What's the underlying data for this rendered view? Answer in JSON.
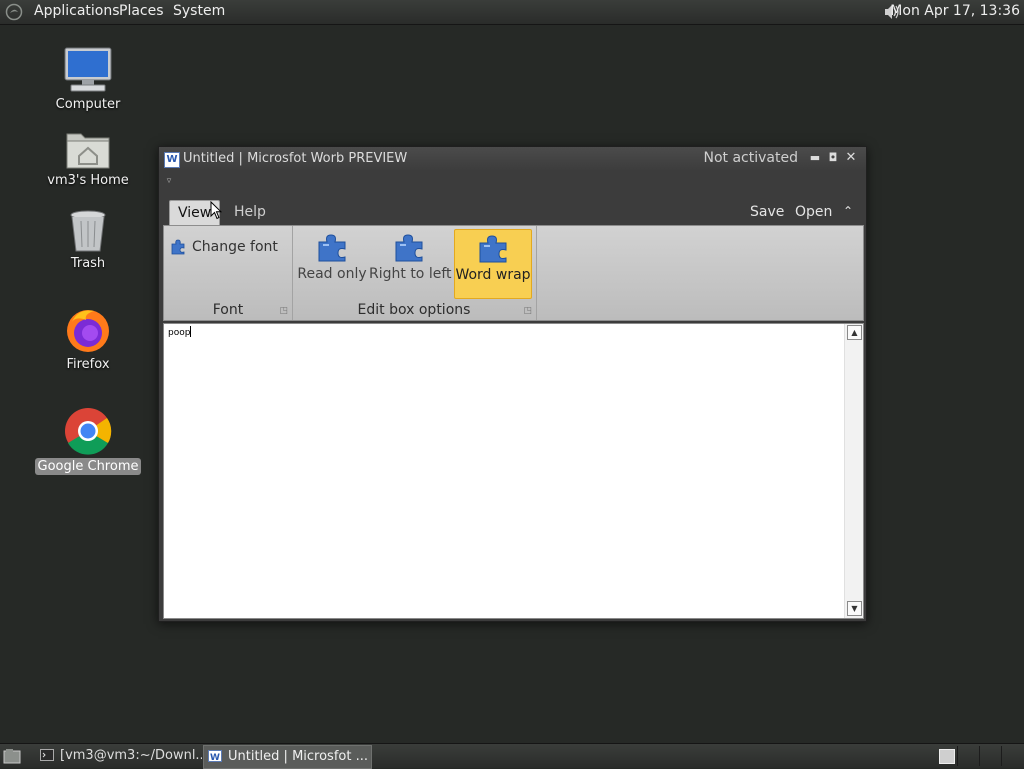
{
  "top_panel": {
    "menus": [
      "Applications",
      "Places",
      "System"
    ],
    "clock": "Mon Apr 17, 13:36"
  },
  "desktop": {
    "icons": [
      {
        "label": "Computer",
        "icon": "computer-icon"
      },
      {
        "label": "vm3's Home",
        "icon": "home-folder-icon"
      },
      {
        "label": "Trash",
        "icon": "trash-icon"
      },
      {
        "label": "Firefox",
        "icon": "firefox-icon"
      },
      {
        "label": "Google Chrome",
        "icon": "chrome-icon",
        "selected": true
      }
    ]
  },
  "window": {
    "title": "Untitled | Microsfot Worb PREVIEW",
    "status": "Not activated",
    "tabs": [
      "View",
      "Help"
    ],
    "active_tab": "View",
    "actions": {
      "save": "Save",
      "open": "Open"
    },
    "ribbon": {
      "font_group": {
        "title": "Font",
        "change_font": "Change font"
      },
      "editbox_group": {
        "title": "Edit box options",
        "read_only": "Read only",
        "right_to_left": "Right to left",
        "word_wrap": "Word wrap",
        "word_wrap_active": true
      }
    },
    "editor_text": "poop"
  },
  "taskbar": {
    "tasks": [
      {
        "label": "[vm3@vm3:~/Downl...",
        "icon": "terminal-icon"
      },
      {
        "label": "Untitled | Microsfot ...",
        "icon": "word-app-icon",
        "active": true
      }
    ]
  },
  "colors": {
    "desktop_bg": "#262926",
    "ribbon_bg": "#c8c8c8",
    "active_button": "#f8cf52",
    "puzzle_blue": "#3f74c8"
  }
}
